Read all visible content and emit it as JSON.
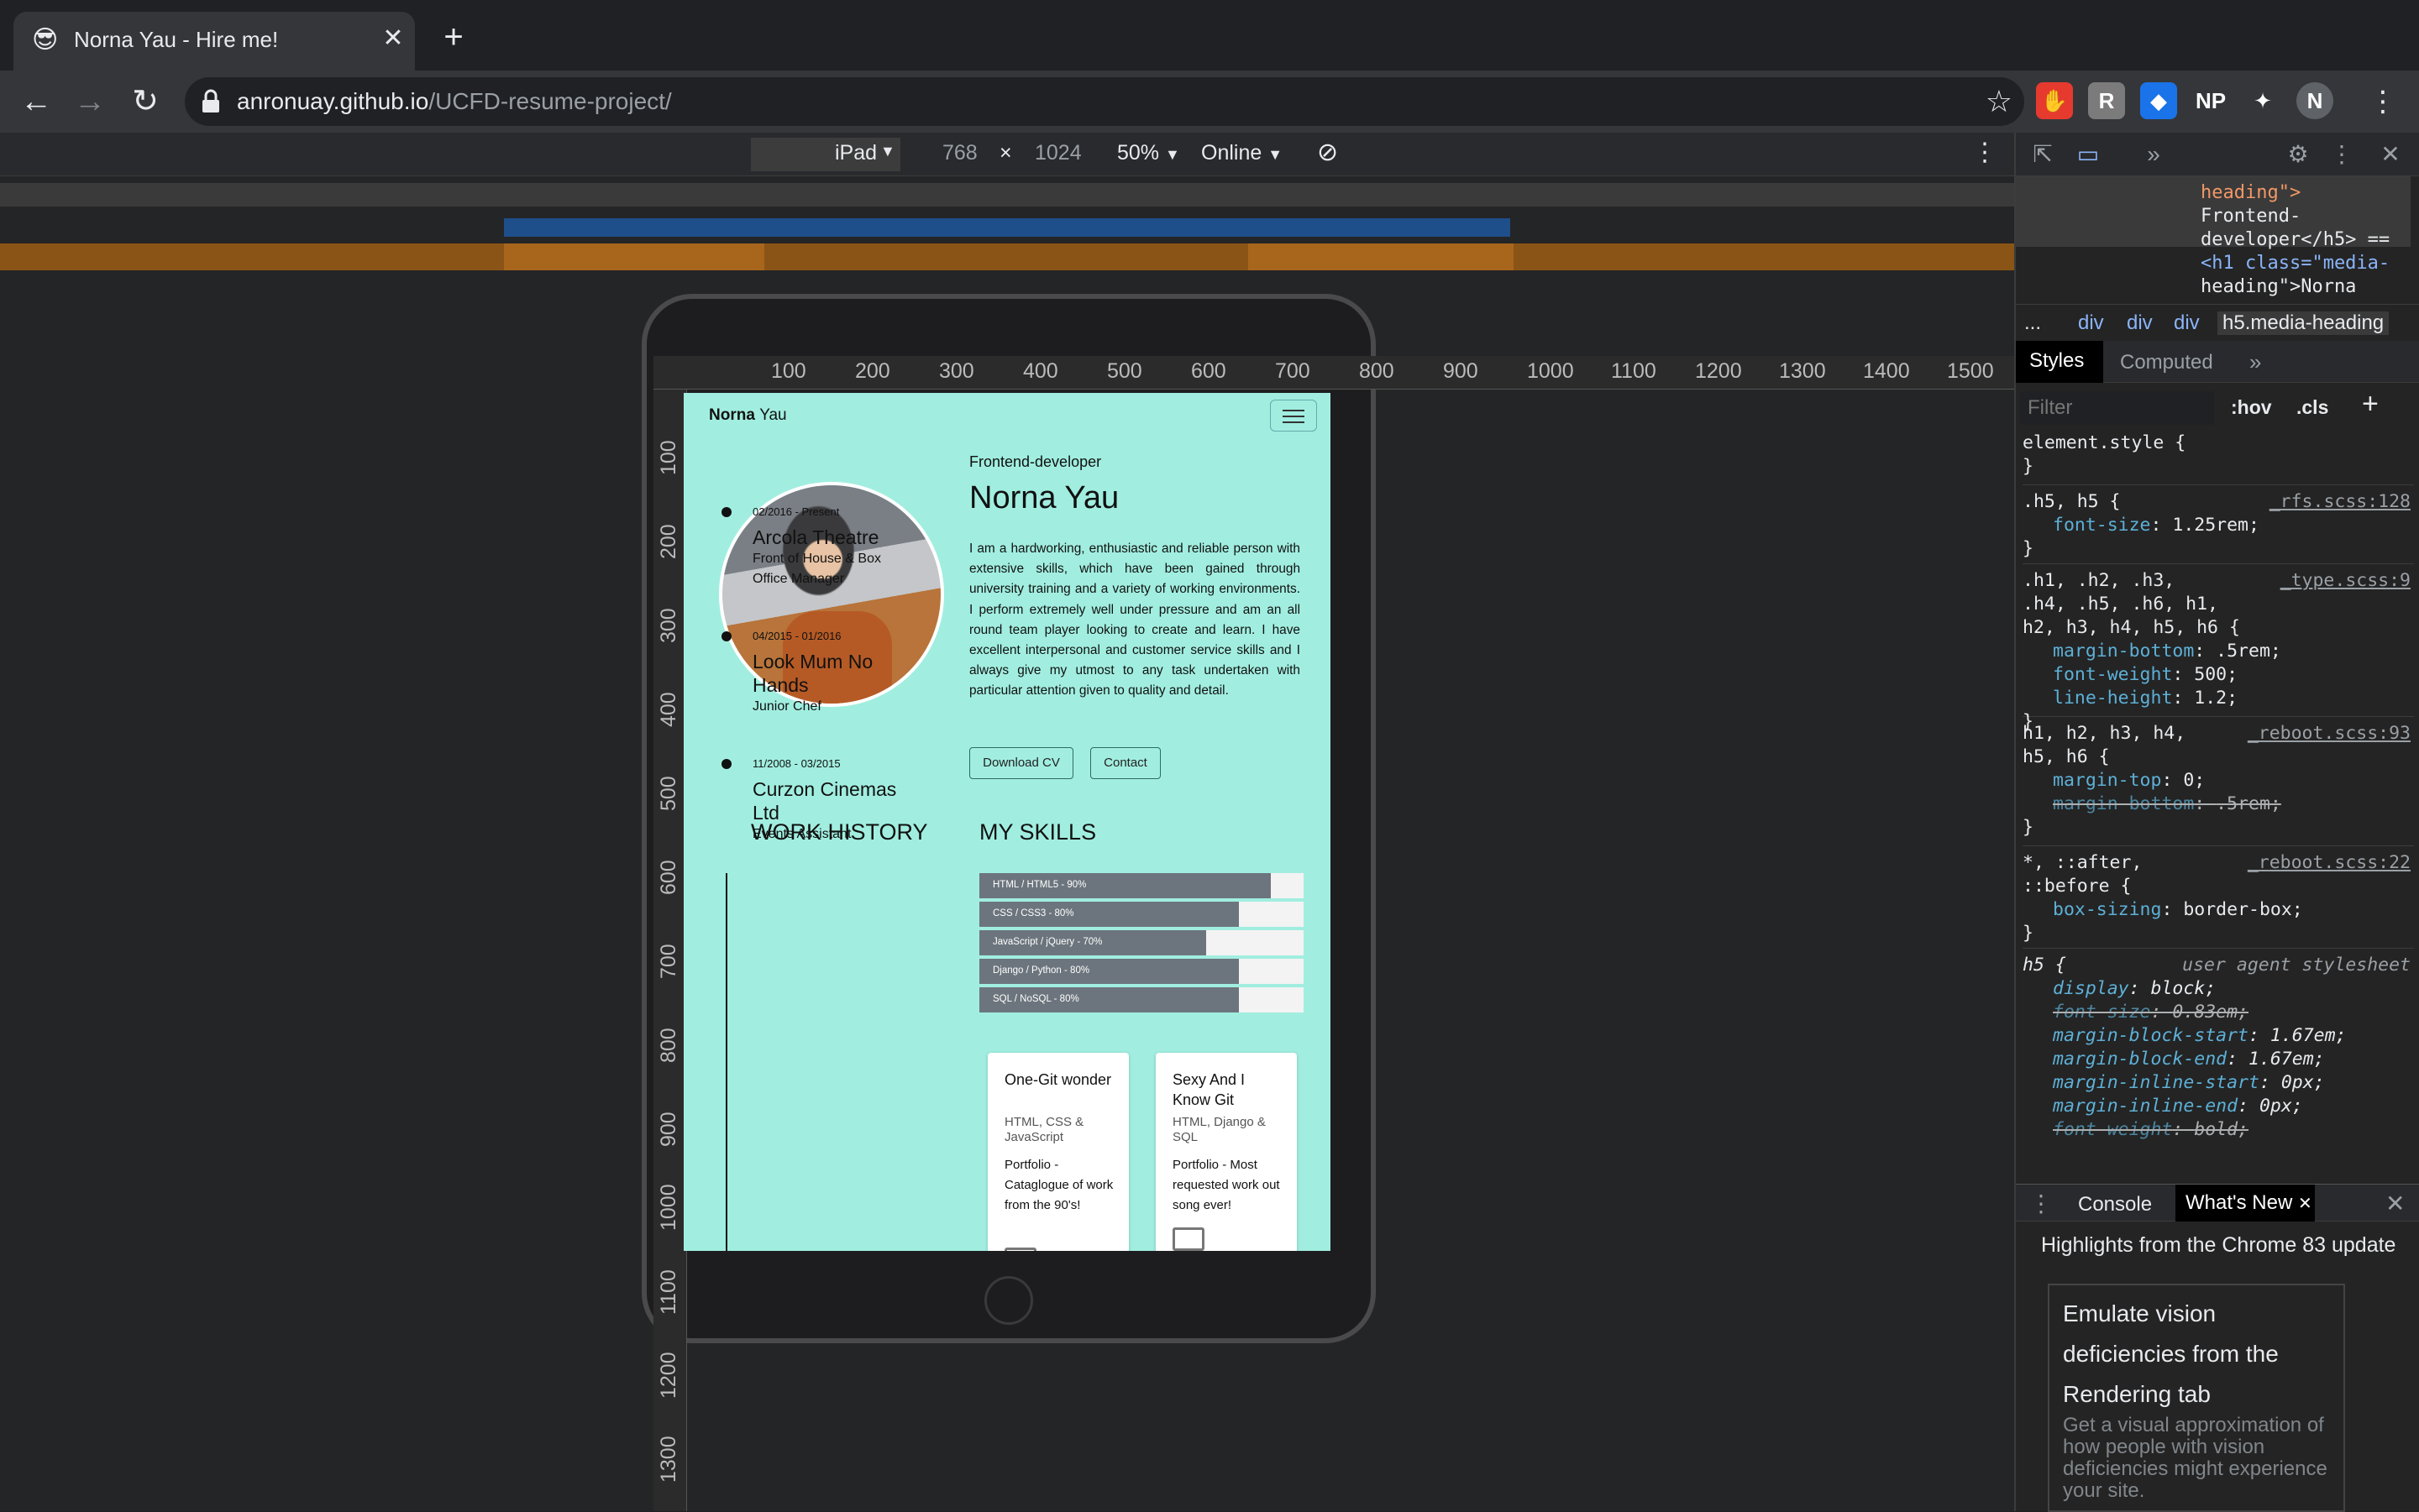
{
  "browser": {
    "tab": {
      "favicon": "😎",
      "title": "Norna Yau - Hire me!",
      "close": "✕"
    },
    "new_tab": "+",
    "url_host": "anronuay.github.io",
    "url_path": "/UCFD-resume-project/",
    "extensions": [
      {
        "name": "adblock-icon",
        "glyph": "✋",
        "bg": "#e63a2e"
      },
      {
        "name": "reader-icon",
        "glyph": "R",
        "bg": "#7b7b7b"
      },
      {
        "name": "cube-icon",
        "glyph": "◆",
        "bg": "#1a73e8"
      },
      {
        "name": "np-icon",
        "glyph": "NP",
        "bg": "#35363a"
      },
      {
        "name": "puzzle-icon",
        "glyph": "✦",
        "bg": "#35363a"
      },
      {
        "name": "avatar",
        "glyph": "N",
        "bg": "#5f6368"
      }
    ]
  },
  "device_toolbar": {
    "device": "iPad",
    "width": "768",
    "times": "×",
    "height": "1024",
    "zoom": "50%",
    "throttle": "Online"
  },
  "rulers": {
    "h": [
      "100",
      "200",
      "300",
      "400",
      "500",
      "600",
      "700",
      "800",
      "900",
      "1000",
      "1100",
      "1200",
      "1300",
      "1400",
      "1500"
    ],
    "v": [
      "100",
      "200",
      "300",
      "400",
      "500",
      "600",
      "700",
      "800",
      "900",
      "1000",
      "1100",
      "1200",
      "1300"
    ]
  },
  "site": {
    "brand_first": "Norna",
    "brand_last": "Yau",
    "kicker": "Frontend-developer",
    "name": "Norna Yau",
    "bio": "I am a hardworking, enthusiastic and reliable person with extensive skills, which have been gained through university training and a variety of working environments. I perform extremely well under pressure and am an all round team player looking to create and learn. I have excellent interpersonal and customer service skills and I always give my utmost to any task undertaken with particular attention given to quality and detail.",
    "download_cv": "Download CV",
    "contact": "Contact",
    "work_heading": "WORK HISTORY",
    "skills_heading": "MY SKILLS",
    "jobs": [
      {
        "date": "02/2016 - Present",
        "title": "Arcola Theatre",
        "role": "Front of House & Box Office Manager"
      },
      {
        "date": "04/2015 - 01/2016",
        "title": "Look Mum No Hands",
        "role": "Junior Chef"
      },
      {
        "date": "11/2008 - 03/2015",
        "title": "Curzon Cinemas Ltd",
        "role": "Events Assistant"
      }
    ],
    "skills": [
      {
        "label": "HTML / HTML5 - 90%",
        "level": 0.9
      },
      {
        "label": "CSS / CSS3 - 80%",
        "level": 0.8
      },
      {
        "label": "JavaScript / jQuery - 70%",
        "level": 0.7
      },
      {
        "label": "Django / Python - 80%",
        "level": 0.8
      },
      {
        "label": "SQL / NoSQL - 80%",
        "level": 0.8
      }
    ],
    "projects": [
      {
        "title": "One-Git wonder",
        "sub": "HTML, CSS & JavaScript",
        "text": "Portfolio - Cataglogue of work from the 90's!"
      },
      {
        "title": "Sexy And I Know Git",
        "sub": "HTML, Django & SQL",
        "text": "Portfolio - Most requested work out song ever!"
      }
    ]
  },
  "devtools": {
    "elements_lines": [
      {
        "t": "heading\">",
        "c": "#f29766"
      },
      {
        "t": "Frontend-",
        "c": "#e8eaed"
      },
      {
        "t": "developer</h5> ==",
        "c": "#e8eaed"
      },
      {
        "t": "<h1 class=\"media-",
        "c": "#8ab4f8"
      },
      {
        "t": "heading\">Norna",
        "c": "#e8eaed"
      }
    ],
    "crumbs": [
      "...",
      "div",
      "div",
      "div",
      "h5.media-heading"
    ],
    "tabs": [
      "Styles",
      "Computed",
      "»"
    ],
    "filter_placeholder": "Filter",
    "hov": ":hov",
    "cls": ".cls",
    "plus": "+",
    "drawer_tabs": [
      "Console",
      "What's New"
    ],
    "drawer_headline": "Highlights from the Chrome 83 update",
    "emu_title": "Emulate vision deficiencies from the Rendering tab",
    "emu_desc": "Get a visual approximation of how people with vision deficiencies might experience your site.",
    "rules": {
      "r1_sel": "element.style {",
      "r1_end": "}",
      "r2_sel": ".h5, h5 {",
      "r2_src": "_rfs.scss:128",
      "r2_p1": "font-size",
      "r2_v1": "1.25rem;",
      "r2_end": "}",
      "r3_sel1": ".h1, .h2, .h3,",
      "r3_sel2": ".h4, .h5, .h6, h1,",
      "r3_sel3": "h2, h3, h4, h5, h6 {",
      "r3_src": "_type.scss:9",
      "r3_p1": "margin-bottom",
      "r3_v1": ".5rem;",
      "r3_p2": "font-weight",
      "r3_v2": "500;",
      "r3_p3": "line-height",
      "r3_v3": "1.2;",
      "r3_end": "}",
      "r4_sel1": "h1, h2, h3, h4,",
      "r4_sel2": "h5, h6 {",
      "r4_src": "_reboot.scss:93",
      "r4_p1": "margin-top",
      "r4_v1": "0;",
      "r4_p2": "margin-bottom",
      "r4_v2": ".5rem;",
      "r4_end": "}",
      "r5_sel1": "*, ::after,",
      "r5_sel2": "::before {",
      "r5_src": "_reboot.scss:22",
      "r5_p1": "box-sizing",
      "r5_v1": "border-box;",
      "r5_end": "}",
      "r6_sel": "h5 {",
      "r6_src": "user agent stylesheet",
      "r6_props": [
        {
          "p": "display",
          "v": "block;",
          "strike": false
        },
        {
          "p": "font-size",
          "v": "0.83em;",
          "strike": true
        },
        {
          "p": "margin-block-start",
          "v": "1.67em;",
          "strike": false
        },
        {
          "p": "margin-block-end",
          "v": "1.67em;",
          "strike": false
        },
        {
          "p": "margin-inline-start",
          "v": "0px;",
          "strike": false
        },
        {
          "p": "margin-inline-end",
          "v": "0px;",
          "strike": false
        },
        {
          "p": "font-weight",
          "v": "bold;",
          "strike": true
        }
      ]
    }
  }
}
